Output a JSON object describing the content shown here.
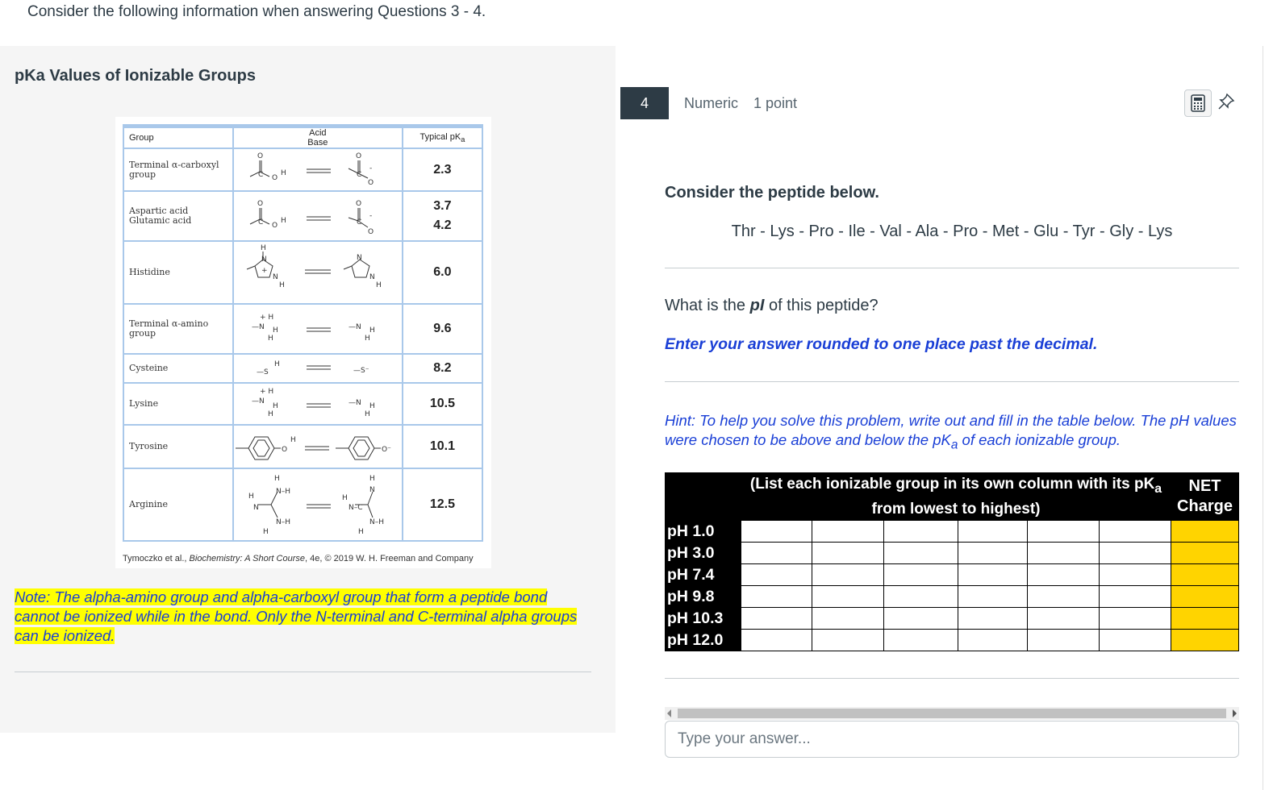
{
  "instructions": "Consider the following information when answering Questions 3 - 4.",
  "left": {
    "heading": "pKa Values of Ionizable Groups",
    "table": {
      "headers": {
        "group": "Group",
        "acid": "Acid",
        "base": "Base",
        "pk": "Typical pK",
        "pk_sub": "a"
      },
      "rows": [
        {
          "group": "Terminal α-carboxyl group",
          "pk": "2.3"
        },
        {
          "group": "Aspartic acid",
          "group2": "Glutamic acid",
          "pk": "3.7",
          "pk2": "4.2"
        },
        {
          "group": "Histidine",
          "pk": "6.0"
        },
        {
          "group": "Terminal α-amino group",
          "pk": "9.6"
        },
        {
          "group": "Cysteine",
          "pk": "8.2"
        },
        {
          "group": "Lysine",
          "pk": "10.5"
        },
        {
          "group": "Tyrosine",
          "pk": "10.1"
        },
        {
          "group": "Arginine",
          "pk": "12.5"
        }
      ],
      "credit_pre": "Tymoczko et al., ",
      "credit_title": "Biochemistry: A Short Course",
      "credit_post": ", 4e, © 2019 W. H. Freeman and Company"
    },
    "note": "Note: The alpha-amino group and alpha-carboxyl group that form a peptide bond cannot be ionized while in the bond. Only the N-terminal and C-terminal alpha groups can be ionized."
  },
  "question": {
    "number": "4",
    "type": "Numeric",
    "points": "1 point",
    "consider": "Consider the peptide below.",
    "peptide": "Thr - Lys - Pro - Ile - Val - Ala - Pro - Met - Glu - Tyr - Gly - Lys",
    "what_pre": "What is the ",
    "what_pi": "pI",
    "what_post": " of this peptide?",
    "enter": "Enter your answer rounded to one place past the decimal.",
    "hint_pre": "Hint: To help you solve this problem, write out and fill in the table below. The pH values were chosen to be above and below the pK",
    "hint_sub": "a",
    "hint_post": " of each ionizable group.",
    "table": {
      "header_list_pre": "(List each ionizable group in its own column with its pK",
      "header_list_sub": "a",
      "header_list_post": " from lowest to highest)",
      "header_net": "NET Charge",
      "rows": [
        "pH 1.0",
        "pH 3.0",
        "pH 7.4",
        "pH 9.8",
        "pH 10.3",
        "pH 12.0"
      ]
    },
    "answer_placeholder": "Type your answer..."
  },
  "icons": {
    "calculator": "calculator-icon",
    "pin": "pin-icon"
  },
  "colors": {
    "accent_blue": "#1a3fd6",
    "highlight": "#ffff00",
    "net_cell": "#ffd400",
    "qnum_bg": "#2d3b45"
  }
}
